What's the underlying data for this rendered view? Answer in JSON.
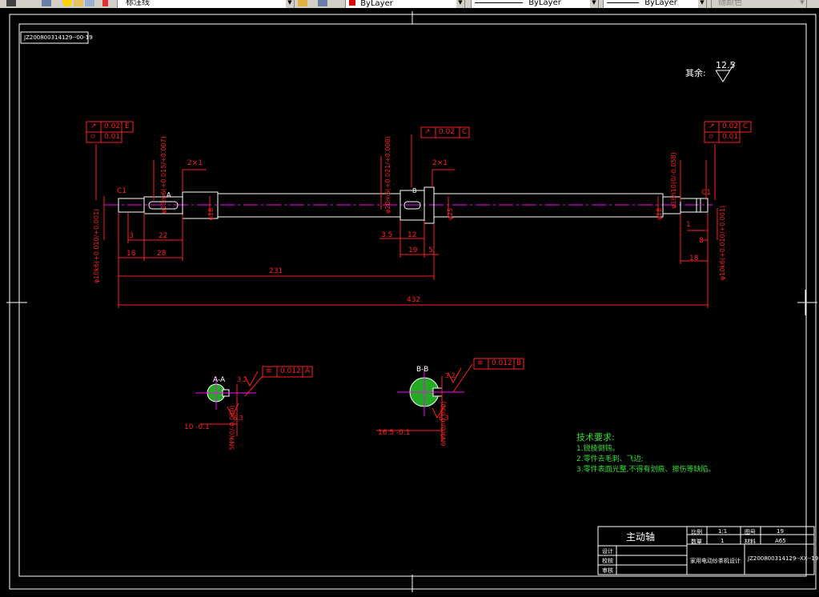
{
  "toolbar": {
    "layer_name": "标注线",
    "color": "ByLayer",
    "linetype": "ByLayer",
    "lineweight": "ByLayer",
    "plotstyle": "随颜色"
  },
  "drawing": {
    "drawing_number": "JZ200800314129--00-19",
    "roughness_prefix": "其余:",
    "roughness_value": "12.5",
    "section_a": "A-A",
    "section_b": "B-B",
    "marker_a": "A",
    "marker_b": "B",
    "dims": {
      "d231": "231",
      "d432": "432",
      "d18_left": "18",
      "d28": "28",
      "d3": "3",
      "d22": "22",
      "d3_5": "3.5",
      "d12": "12",
      "d19": "19",
      "d5": "5",
      "d18_right": "18",
      "d1": "1",
      "d8": "8",
      "chamfer_left": "2×1",
      "chamfer_mid": "2×1",
      "phi10_left": "φ10k6(+0.010/+0.001)",
      "phi12": "φ13m6(+0.015/+0.007)",
      "phi20": "φ20m6(+0.021/+0.008)",
      "phi18_left": "φ18",
      "phi25": "φ25",
      "phi16_right": "φ16h10(0/-0.058)",
      "phi18_right": "φ18",
      "phi10_right": "φ10k6(+0.010/+0.001)",
      "c1_left": "C1",
      "c1_right": "C1",
      "sec_a_depth": "10 -0.1",
      "sec_a_width": "5N9(0/-0.030)",
      "sec_b_depth": "16.5 -0.1",
      "sec_b_width": "6N9(0/-0.030)",
      "ra_small": "3.2",
      "ra_63": "6.3"
    },
    "tolerances": {
      "left_runout": "0.02",
      "left_runout_datum": "E",
      "left_cyl": "0.01",
      "mid_runout": "0.02",
      "mid_runout_datum": "C",
      "right_runout": "0.02",
      "right_runout_datum": "C",
      "right_cyl": "0.01",
      "sec_a_sym": "0.012",
      "sec_a_datum": "A",
      "sec_b_sym": "0.012",
      "sec_b_datum": "B"
    },
    "notes": {
      "title": "技术要求:",
      "items": [
        "1.锐棱倒钝。",
        "2.零件去毛刺、飞边;",
        "3.零件表面光整,不得有划痕、擦伤等缺陷。"
      ]
    },
    "title_block": {
      "part_name": "主动轴",
      "scale_label": "比例",
      "scale_value": "1:1",
      "drawing_no_label": "图号",
      "drawing_no_value": "19",
      "quantity_label": "数量",
      "quantity_value": "1",
      "material_label": "材料",
      "material_value": "A65",
      "designed_label": "设计",
      "checked_label": "校核",
      "approved_label": "审核",
      "project": "家用电动炒茶机设计",
      "code": "JZ200800314129--XX--19"
    }
  }
}
